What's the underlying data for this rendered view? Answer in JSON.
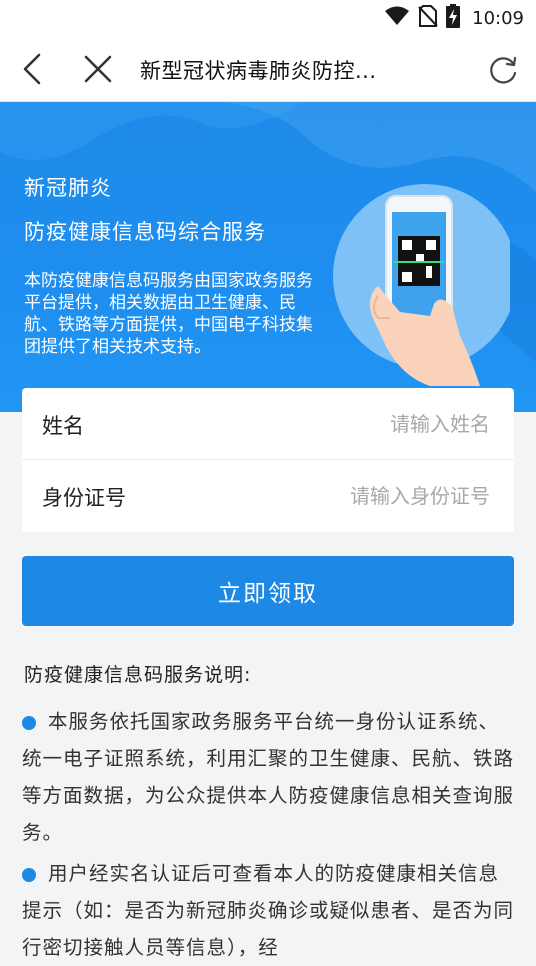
{
  "status_bar": {
    "time": "10:09",
    "icons": [
      "wifi-icon",
      "no-sim-icon",
      "battery-charging-icon"
    ]
  },
  "toolbar": {
    "title": "新型冠状病毒肺炎防控...",
    "icons": [
      "back-icon",
      "close-icon",
      "refresh-icon"
    ]
  },
  "hero": {
    "title_line1": "新冠肺炎",
    "title_line2": "防疫健康信息码综合服务",
    "description": "本防疫健康信息码服务由国家政务服务平台提供，相关数据由卫生健康、民航、铁路等方面提供，中国电子科技集团提供了相关技术支持。"
  },
  "form": {
    "name_label": "姓名",
    "name_placeholder": "请输入姓名",
    "name_value": "",
    "id_label": "身份证号",
    "id_placeholder": "请输入身份证号",
    "id_value": ""
  },
  "submit_label": "立即领取",
  "notes": {
    "title": "防疫健康信息码服务说明:",
    "items": [
      "本服务依托国家政务服务平台统一身份认证系统、统一电子证照系统，利用汇聚的卫生健康、民航、铁路等方面数据，为公众提供本人防疫健康信息相关查询服务。",
      "用户经实名认证后可查看本人的防疫健康相关信息提示（如：是否为新冠肺炎确诊或疑似患者、是否为同行密切接触人员等信息），经"
    ]
  },
  "colors": {
    "accent": "#1e88e5",
    "hero_bg": "#1d8ef0"
  }
}
